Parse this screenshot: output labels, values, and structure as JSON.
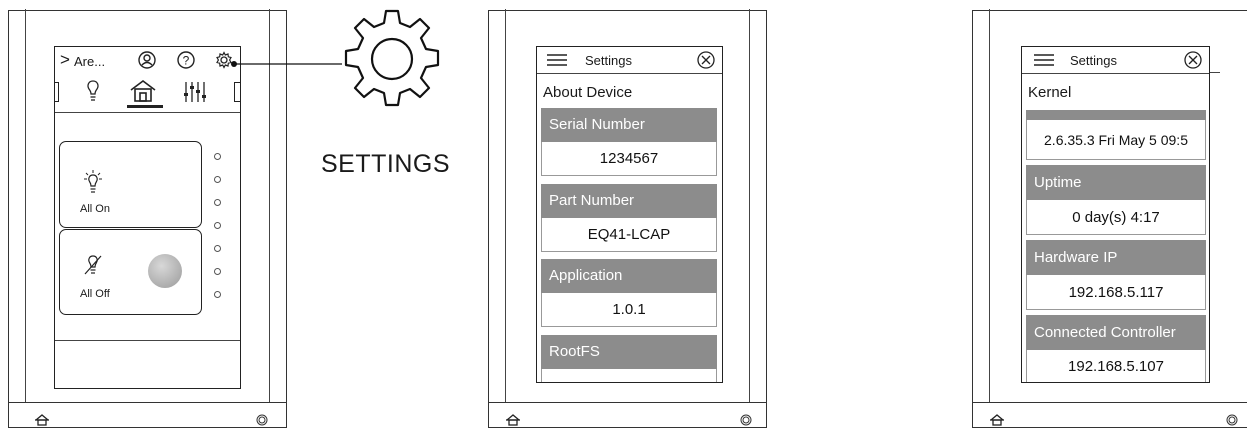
{
  "panel1": {
    "nav_label": "Are...",
    "card_all_on": "All On",
    "card_all_off": "All Off"
  },
  "callout": {
    "label": "SETTINGS"
  },
  "panel2": {
    "header_title": "Settings",
    "section_title": "About Device",
    "fields": [
      {
        "label": "Serial Number",
        "value": "1234567"
      },
      {
        "label": "Part Number",
        "value": "EQ41-LCAP"
      },
      {
        "label": "Application",
        "value": "1.0.1"
      },
      {
        "label": "RootFS",
        "value": ""
      }
    ]
  },
  "panel3": {
    "header_title": "Settings",
    "section_title": "Kernel",
    "kernel_value": "2.6.35.3 Fri May 5 09:5",
    "fields": [
      {
        "label": "Uptime",
        "value": "0 day(s) 4:17"
      },
      {
        "label": "Hardware IP",
        "value": "192.168.5.117"
      },
      {
        "label": "Connected Controller",
        "value": "192.168.5.107"
      }
    ]
  },
  "icons": {
    "home": "home-icon",
    "bulb": "lightbulb-icon",
    "bulb_off": "lightbulb-off-icon",
    "gear": "gear-icon",
    "help": "help-icon",
    "user": "user-icon",
    "mixer": "sliders-icon",
    "menu": "hamburger-menu-icon",
    "close": "close-icon"
  },
  "colors": {
    "field_header": "#8c8c8c",
    "line": "#222222"
  }
}
